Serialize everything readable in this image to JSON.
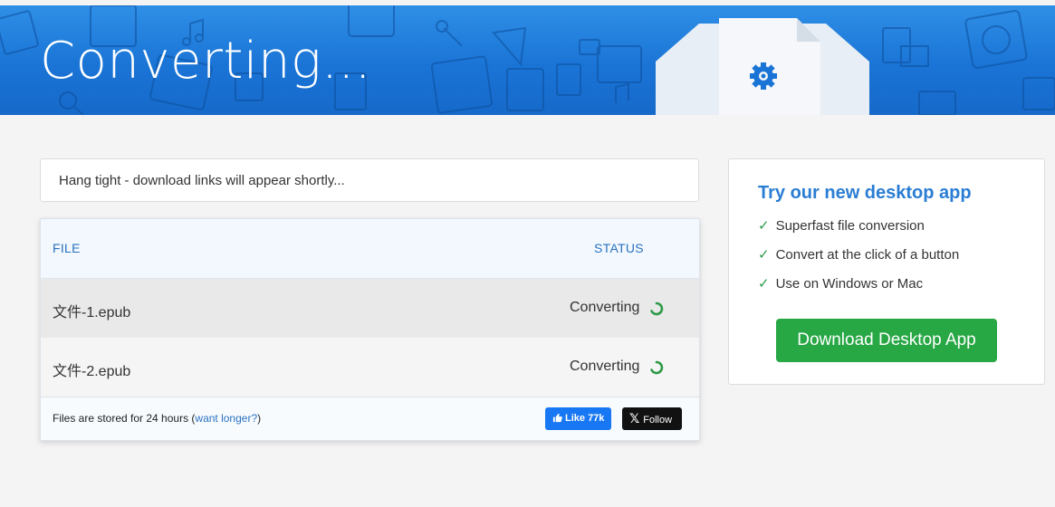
{
  "banner": {
    "title": "Converting..."
  },
  "notice": {
    "text": "Hang tight - download links will appear shortly..."
  },
  "table": {
    "headers": {
      "file": "FILE",
      "status": "STATUS"
    },
    "rows": [
      {
        "file": "文件-1.epub",
        "status": "Converting"
      },
      {
        "file": "文件-2.epub",
        "status": "Converting"
      }
    ],
    "footer": {
      "text_before": "Files are stored for 24 hours (",
      "link": "want longer?",
      "text_after": ")"
    },
    "like_label": "Like 77k",
    "follow_label": "Follow"
  },
  "promo": {
    "title": "Try our new desktop app",
    "features": [
      "Superfast file conversion",
      "Convert at the click of a button",
      "Use on Windows or Mac"
    ],
    "button_label": "Download Desktop App"
  },
  "colors": {
    "banner": "#1a74d6",
    "accent": "#2a7dd4",
    "success": "#28a745",
    "spinner": "#2e9a48"
  }
}
